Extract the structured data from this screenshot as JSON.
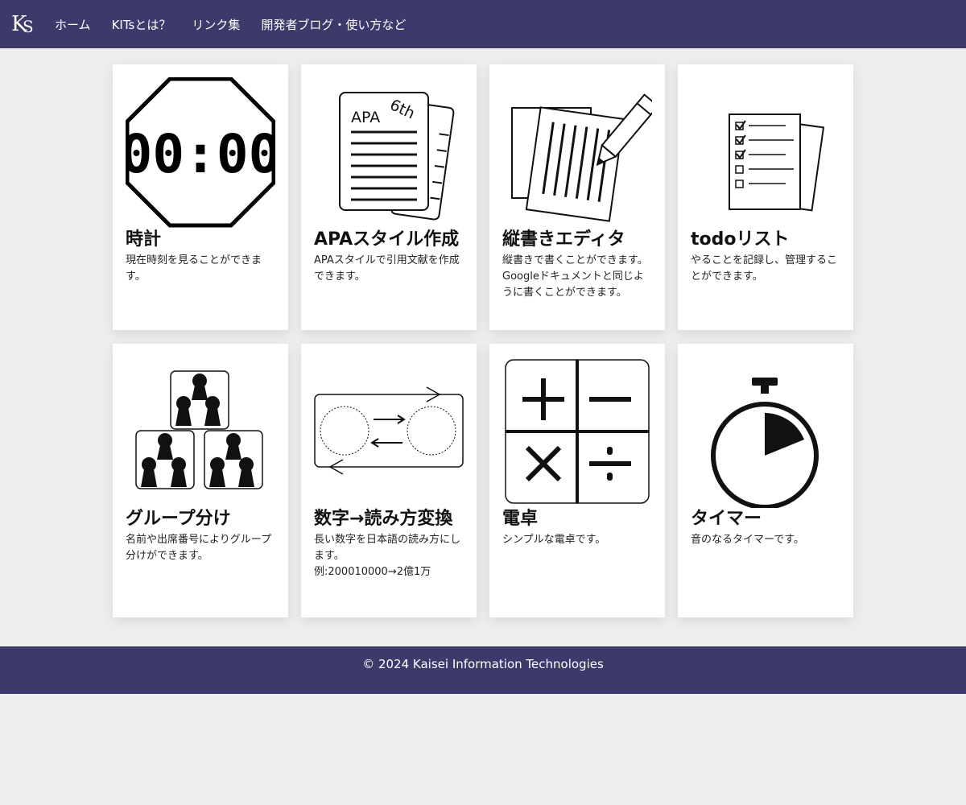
{
  "header": {
    "logo_text_k": "K",
    "logo_text_s": "S",
    "nav": [
      {
        "label": "ホーム"
      },
      {
        "label": "KITsとは？"
      },
      {
        "label": "リンク集"
      },
      {
        "label": "開発者ブログ・使い方など"
      }
    ]
  },
  "cards": [
    {
      "title": "時計",
      "desc": "現在時刻を見ることができます。",
      "icon": "clock-display-icon",
      "clock_text": "00:00"
    },
    {
      "title": "APAスタイル作成",
      "desc": "APAスタイルで引用文献を作成できます。",
      "icon": "apa-document-icon",
      "doc_label": "APA",
      "doc_edition": "6th"
    },
    {
      "title": "縦書きエディタ",
      "desc": "縦書きで書くことができます。\nGoogleドキュメントと同じように書くことができます。",
      "icon": "vertical-editor-icon"
    },
    {
      "title": "todoリスト",
      "desc": "やることを記録し、管理することができます。",
      "icon": "checklist-icon"
    },
    {
      "title": "グループ分け",
      "desc": "名前や出席番号によりグループ分けができます。",
      "icon": "group-icon"
    },
    {
      "title": "数字→読み方変換",
      "desc": "長い数字を日本語の読み方にします。\n例:200010000→2億1万",
      "icon": "convert-icon"
    },
    {
      "title": "電卓",
      "desc": "シンプルな電卓です。",
      "icon": "calculator-icon"
    },
    {
      "title": "タイマー",
      "desc": "音のなるタイマーです。",
      "icon": "stopwatch-icon"
    }
  ],
  "footer": {
    "text": "© 2024 Kaisei Information Technologies"
  },
  "colors": {
    "nav_bg": "#3d3a6b",
    "page_bg": "#eeeeee",
    "card_bg": "#ffffff"
  }
}
